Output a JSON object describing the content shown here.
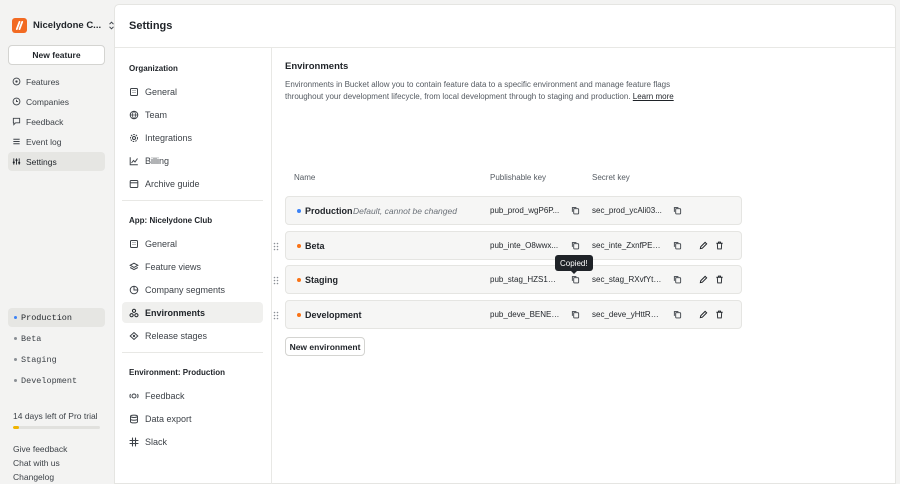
{
  "org": {
    "name": "Nicelydone C..."
  },
  "sidebar": {
    "new_feature_label": "New feature",
    "items": [
      {
        "label": "Features"
      },
      {
        "label": "Companies"
      },
      {
        "label": "Feedback"
      },
      {
        "label": "Event log"
      },
      {
        "label": "Settings",
        "active": true
      }
    ],
    "environments": [
      {
        "label": "Production",
        "active": true
      },
      {
        "label": "Beta"
      },
      {
        "label": "Staging"
      },
      {
        "label": "Development"
      }
    ],
    "trial": {
      "text": "14 days left of Pro trial",
      "progress": 0.07,
      "color": "#f0b400"
    },
    "footer_links": [
      {
        "label": "Give feedback"
      },
      {
        "label": "Chat with us"
      },
      {
        "label": "Changelog"
      }
    ]
  },
  "page": {
    "title": "Settings"
  },
  "settings_nav": {
    "organization": {
      "heading": "Organization",
      "items": [
        {
          "label": "General",
          "icon": "building-icon"
        },
        {
          "label": "Team",
          "icon": "globe-icon"
        },
        {
          "label": "Integrations",
          "icon": "gear-icon"
        },
        {
          "label": "Billing",
          "icon": "chart-line-icon"
        },
        {
          "label": "Archive guide",
          "icon": "archive-icon"
        }
      ]
    },
    "app": {
      "heading": "App: Nicelydone Club",
      "items": [
        {
          "label": "General",
          "icon": "building-icon"
        },
        {
          "label": "Feature views",
          "icon": "layers-icon"
        },
        {
          "label": "Company segments",
          "icon": "pie-chart-icon"
        },
        {
          "label": "Environments",
          "icon": "environments-icon",
          "active": true
        },
        {
          "label": "Release stages",
          "icon": "release-icon"
        }
      ]
    },
    "environment": {
      "heading": "Environment: Production",
      "items": [
        {
          "label": "Feedback",
          "icon": "feedback-icon"
        },
        {
          "label": "Data export",
          "icon": "database-icon"
        },
        {
          "label": "Slack",
          "icon": "slack-icon"
        }
      ]
    }
  },
  "environments_section": {
    "title": "Environments",
    "description": "Environments in Bucket allow you to contain feature data to a specific environment and manage feature flags throughout your development lifecycle, from local development through to staging and production.",
    "learn_more": "Learn more",
    "columns": {
      "name": "Name",
      "publishable": "Publishable key",
      "secret": "Secret key"
    },
    "rows": [
      {
        "name": "Production",
        "note": "Default, cannot be changed",
        "publishable_key": "pub_prod_wgP6P...",
        "secret_key": "sec_prod_ycAli03...",
        "dot_color": "#3b82f6",
        "editable": false
      },
      {
        "name": "Beta",
        "note": "",
        "publishable_key": "pub_inte_O8wwx...",
        "secret_key": "sec_inte_ZxnfPEq...",
        "dot_color": "#f97316",
        "editable": true
      },
      {
        "name": "Staging",
        "note": "",
        "publishable_key": "pub_stag_HZS1a1...",
        "secret_key": "sec_stag_RXvfYtG...",
        "dot_color": "#f97316",
        "editable": true
      },
      {
        "name": "Development",
        "note": "",
        "publishable_key": "pub_deve_BENEfd...",
        "secret_key": "sec_deve_yHttRD...",
        "dot_color": "#f97316",
        "editable": true
      }
    ],
    "tooltip": "Copied!",
    "new_environment_label": "New environment"
  },
  "colors": {
    "brand": "#f26a22",
    "production_dot": "#3b82f6",
    "env_dot": "#f97316"
  }
}
